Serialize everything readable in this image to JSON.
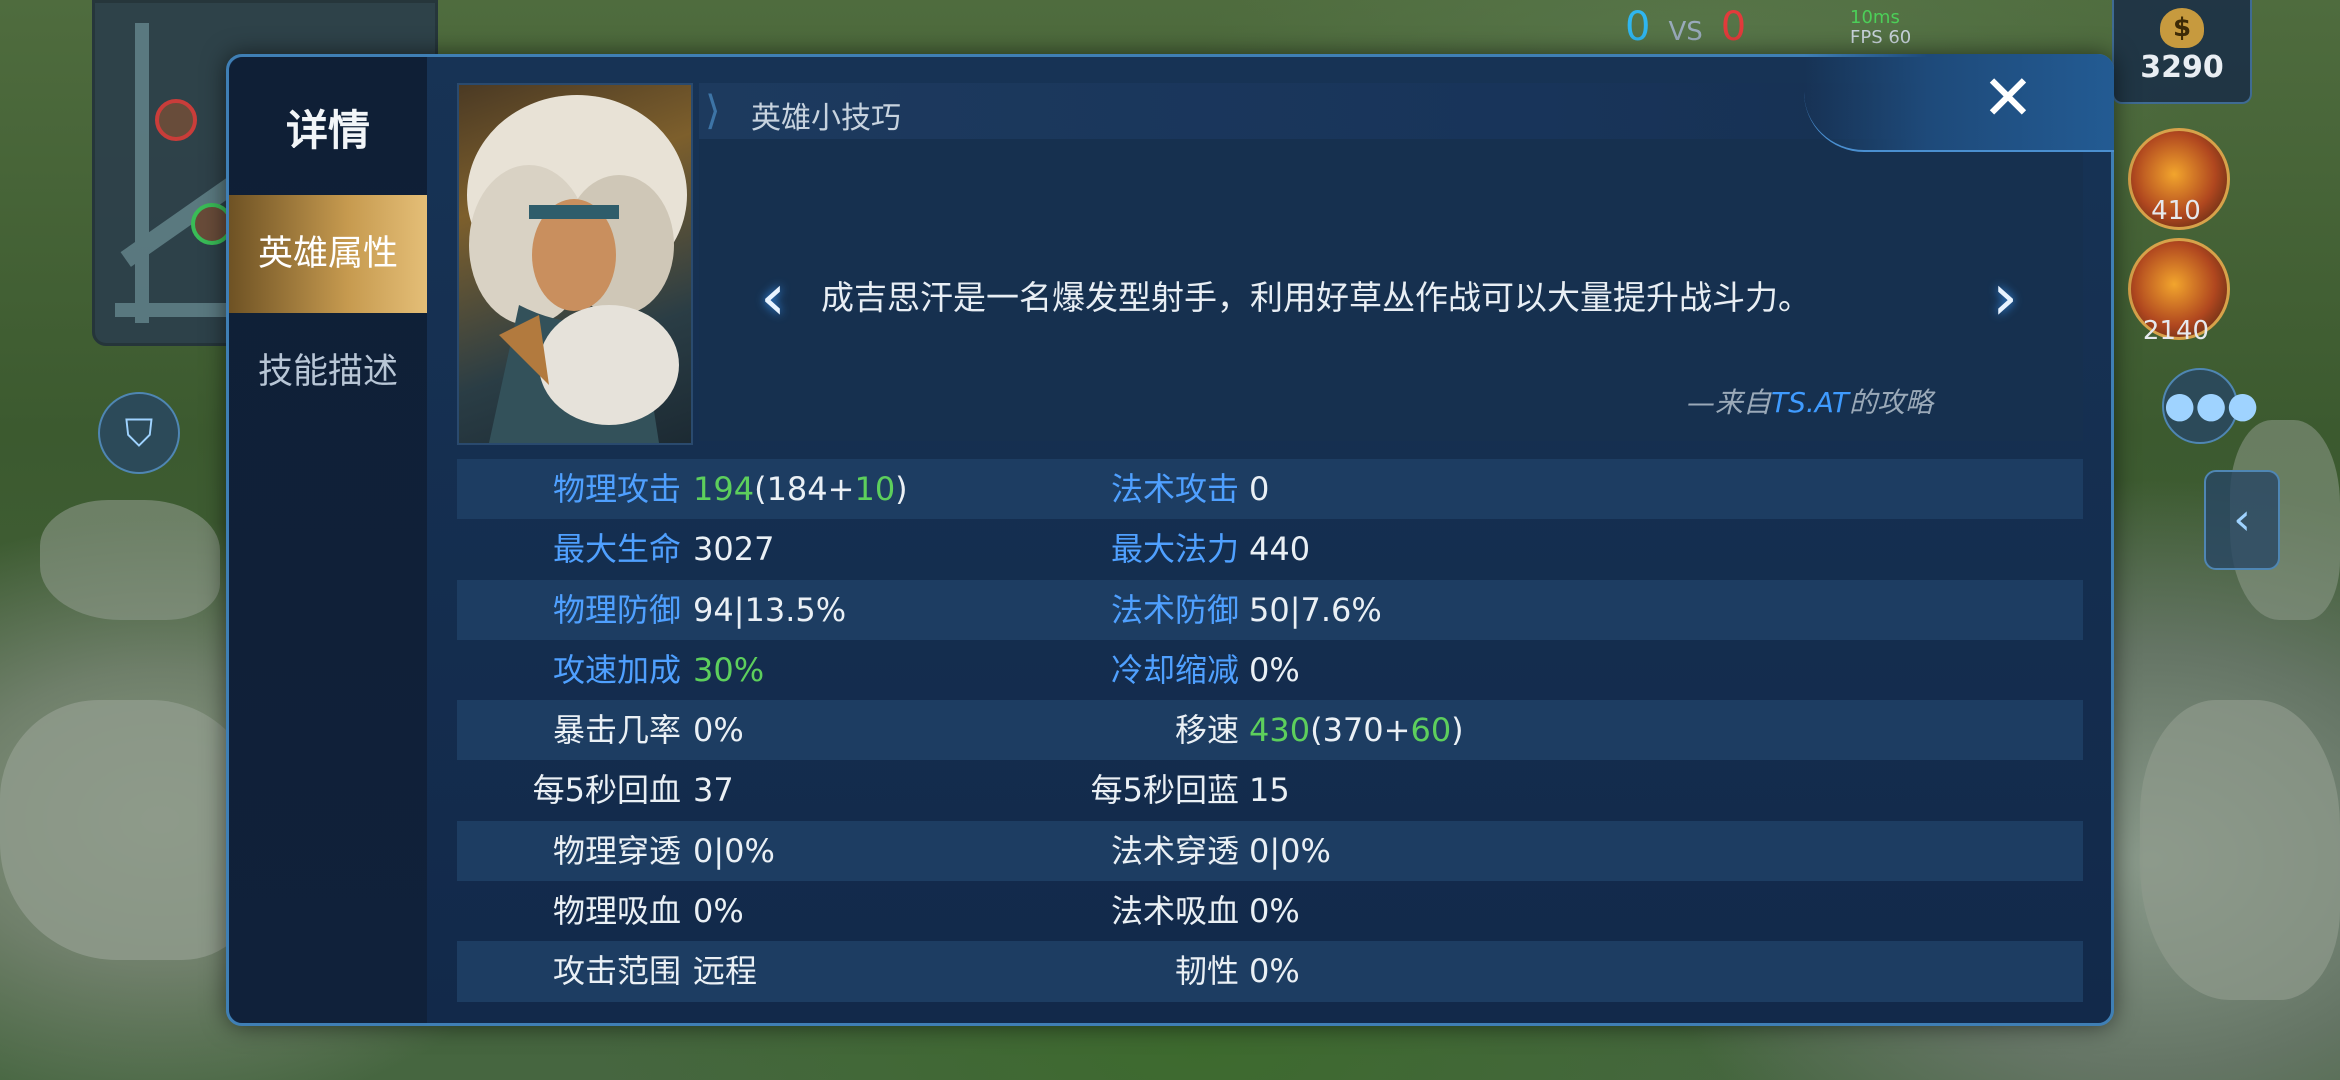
{
  "hud": {
    "score_blue": "0",
    "score_vs": "VS",
    "score_red": "0",
    "ping": "10ms",
    "fps": "FPS 60",
    "gold": "3290",
    "gold_icon_text": "$",
    "item1_price": "410",
    "item2_price": "2140"
  },
  "dialog": {
    "sidebar_title": "详情",
    "tabs": [
      "英雄属性",
      "技能描述"
    ],
    "active_tab": 0,
    "tips_title": "英雄小技巧",
    "tip_text": "成吉思汗是一名爆发型射手，利用好草丛作战可以大量提升战斗力。",
    "tip_source_prefix": "—来自",
    "tip_source_name": "TS.AT",
    "tip_source_suffix": "的攻略",
    "close_label": "✕",
    "prev_label": "‹",
    "next_label": "›"
  },
  "stats": [
    {
      "l_label": "物理攻击",
      "l_blue": true,
      "l_value": [
        {
          "t": "194",
          "g": true
        },
        {
          "t": "(184+"
        },
        {
          "t": "10",
          "g": true
        },
        {
          "t": ")"
        }
      ],
      "r_label": "法术攻击",
      "r_blue": true,
      "r_value": [
        {
          "t": "0"
        }
      ]
    },
    {
      "l_label": "最大生命",
      "l_blue": true,
      "l_value": [
        {
          "t": "3027"
        }
      ],
      "r_label": "最大法力",
      "r_blue": true,
      "r_value": [
        {
          "t": "440"
        }
      ]
    },
    {
      "l_label": "物理防御",
      "l_blue": true,
      "l_value": [
        {
          "t": "94|13.5%"
        }
      ],
      "r_label": "法术防御",
      "r_blue": true,
      "r_value": [
        {
          "t": "50|7.6%"
        }
      ]
    },
    {
      "l_label": "攻速加成",
      "l_blue": true,
      "l_value": [
        {
          "t": "30%",
          "g": true
        }
      ],
      "r_label": "冷却缩减",
      "r_blue": true,
      "r_value": [
        {
          "t": "0%"
        }
      ]
    },
    {
      "l_label": "暴击几率",
      "l_blue": false,
      "l_value": [
        {
          "t": "0%"
        }
      ],
      "r_label": "移速",
      "r_blue": false,
      "r_value": [
        {
          "t": "430",
          "g": true
        },
        {
          "t": "(370+"
        },
        {
          "t": "60",
          "g": true
        },
        {
          "t": ")"
        }
      ]
    },
    {
      "l_label": "每5秒回血",
      "l_blue": false,
      "l_value": [
        {
          "t": "37"
        }
      ],
      "r_label": "每5秒回蓝",
      "r_blue": false,
      "r_value": [
        {
          "t": "15"
        }
      ]
    },
    {
      "l_label": "物理穿透",
      "l_blue": false,
      "l_value": [
        {
          "t": "0|0%"
        }
      ],
      "r_label": "法术穿透",
      "r_blue": false,
      "r_value": [
        {
          "t": "0|0%"
        }
      ]
    },
    {
      "l_label": "物理吸血",
      "l_blue": false,
      "l_value": [
        {
          "t": "0%"
        }
      ],
      "r_label": "法术吸血",
      "r_blue": false,
      "r_value": [
        {
          "t": "0%"
        }
      ]
    },
    {
      "l_label": "攻击范围",
      "l_blue": false,
      "l_value": [
        {
          "t": "远程"
        }
      ],
      "r_label": "韧性",
      "r_blue": false,
      "r_value": [
        {
          "t": "0%"
        }
      ]
    }
  ],
  "colors": {
    "accent_blue": "#4fa0ff",
    "bonus_green": "#5dcf5c",
    "tab_active_gold": "#c69a4f",
    "dialog_border": "#3f7fb5"
  }
}
